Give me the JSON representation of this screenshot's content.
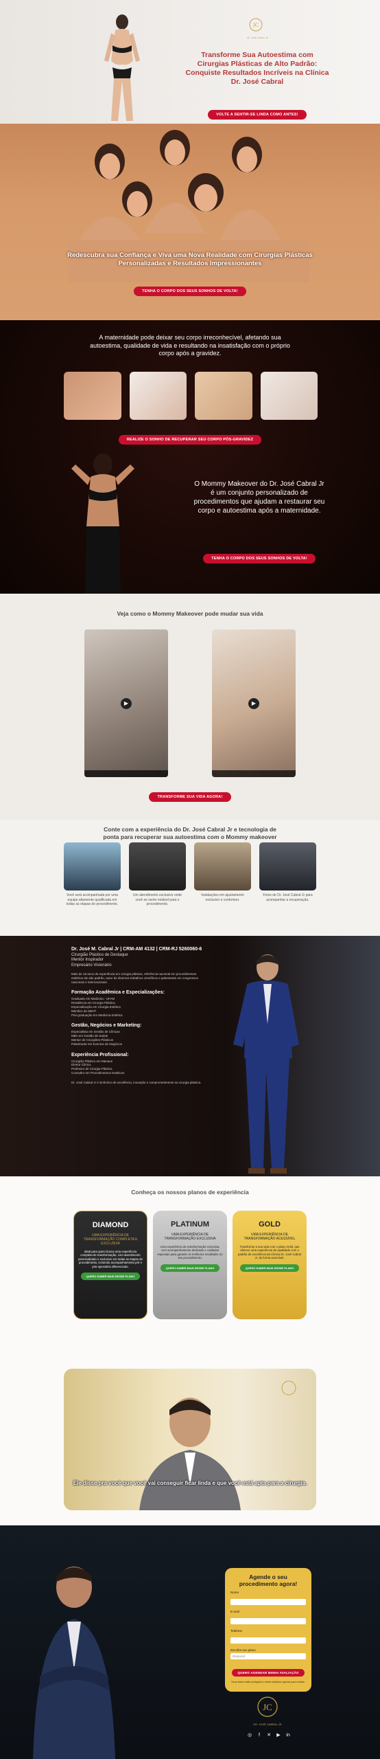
{
  "hero": {
    "title": "Transforme Sua Autoestima com Cirurgias Plásticas de Alto Padrão: Conquiste Resultados Incríveis na Clínica Dr. José Cabral",
    "button": "VOLTE A SENTIR-SE LINDA COMO ANTES!",
    "logo_text": "DR. JOSÉ CABRAL JR"
  },
  "banner": {
    "title": "Redescubra sua Confiança e Viva uma Nova Realidade com Cirurgias Plásticas Personalizadas e Resultados Impressionantes",
    "button": "TENHA O CORPO DOS SEUS SONHOS DE VOLTA!"
  },
  "maternity": {
    "text": "A maternidade pode deixar seu corpo irreconhecível, afetando sua autoestima, qualidade de vida e resultando na insatisfação com o próprio corpo após a gravidez.",
    "button1": "REALIZE O SONHO DE RECUPERAR SEU CORPO PÓS-GRAVIDEZ",
    "text2": "O Mommy Makeover do Dr. José Cabral Jr é um conjunto personalizado de procedimentos que ajudam a restaurar seu corpo e autoestima após a maternidade.",
    "button2": "TENHA O CORPO DOS SEUS SONHOS DE VOLTA!"
  },
  "videos": {
    "title": "Veja como o Mommy Makeover pode mudar sua vida",
    "button": "TRANSFORME SUA VIDA AGORA!"
  },
  "experience": {
    "title": "Conte com a experiência do Dr. José Cabral Jr e tecnologia de ponta para recuperar sua autoestima com o Mommy makeover",
    "cards": [
      "Você será acompanhada por uma equipe altamente qualificada em todas as etapas do procedimento.",
      "Um atendimento exclusivo onde você se sente notável para o procedimento.",
      "Instalações em ajustamento exclusivo e conforteer.",
      "Fotos de Dr. José Cabral Jr para acompanhar a recuperação."
    ]
  },
  "doctor": {
    "name": "Dr. José M. Cabral Jr | CRM-AM 4132 | CRM-RJ 5260060-6",
    "roles": [
      "Cirurgião Plástico de Destaque",
      "Mentor Inspirador",
      "Empresário Visionário"
    ],
    "intro": "Mais de 18 anos de experiência em cirurgia plástica, referência nacional em procedimentos estéticos de alto padrão, autor de diversos trabalhos científicos e palestrante em congressos nacionais e internacionais.",
    "sections": [
      {
        "title": "Formação Acadêmica e Especializações:",
        "lines": [
          "Graduado em Medicina - UFAM",
          "Residência em Cirurgia Plástica",
          "Especialização em Cirurgia Estética",
          "Membro da SBCP",
          "Pós-graduação em Medicina Estética"
        ]
      },
      {
        "title": "Gestão, Negócios e Marketing:",
        "lines": [
          "Especialista em Gestão de Clínicas",
          "MBA em Gestão de Saúde",
          "Mentor de Cirurgiões Plásticos",
          "Palestrante em Eventos de Negócios"
        ]
      },
      {
        "title": "Experiência Profissional:",
        "lines": [
          "Cirurgião Plástico em Manaus",
          "Diretor Clínico",
          "Professor de Cirurgia Plástica",
          "Consultor em Procedimentos Estéticos"
        ]
      }
    ],
    "closing": "Dr. José Cabral Jr é sinônimo de excelência, inovação e comprometimento na cirurgia plástica."
  },
  "plans": {
    "title": "Conheça os nossos planos de experiência",
    "items": [
      {
        "name": "DIAMOND",
        "subtitle": "UMA EXPERIÊNCIA DE TRANSFORMAÇÃO COMPLETA E EXCLUSIVA",
        "desc": "Ideal para quem busca uma experiência completa de transformação, com atendimento personalizado e exclusivo em todas as etapas do procedimento, incluindo acompanhamento pré e pós-operatório diferenciado.",
        "button": "QUERO SABER MAIS DESSE PLANO"
      },
      {
        "name": "PLATINUM",
        "subtitle": "UMA EXPERIÊNCIA DE TRANSFORMAÇÃO EXCLUSIVA",
        "desc": "Uma experiência de transformação exclusiva, com acompanhamento dedicado e cuidados especiais para garantir os melhores resultados no seu procedimento.",
        "button": "QUERO SABER MAIS DESSE PLANO"
      },
      {
        "name": "GOLD",
        "subtitle": "UMA EXPERIÊNCIA DE TRANSFORMAÇÃO ACESSÍVEL",
        "desc": "Transforme a sua vida com o plano Gold, que oferece uma experiência de qualidade com o padrão de excelência da Clínica Dr. José Cabral Jr, de forma acessível.",
        "button": "QUERO SABER MAIS DESSE PLANO"
      }
    ],
    "video_caption": "Ele disse pra você que você vai conseguir ficar linda e que você está apta para a cirurgia."
  },
  "form": {
    "title": "Agende o seu procedimento agora!",
    "fields": [
      {
        "label": "Nome",
        "placeholder": ""
      },
      {
        "label": "E-mail",
        "placeholder": ""
      },
      {
        "label": "Telefone",
        "placeholder": ""
      },
      {
        "label": "Escolha seu plano",
        "placeholder": "Diamond"
      }
    ],
    "button": "QUERO AGENDAR MINHA AVALIAÇÃO",
    "note": "Seus dados estão protegidos e serão utilizados apenas para contato.",
    "logo_text": "DR. JOSÉ CABRAL JR"
  },
  "colors": {
    "accent": "#c8102e",
    "gold": "#c9a24a",
    "whatsapp": "#25d366"
  }
}
